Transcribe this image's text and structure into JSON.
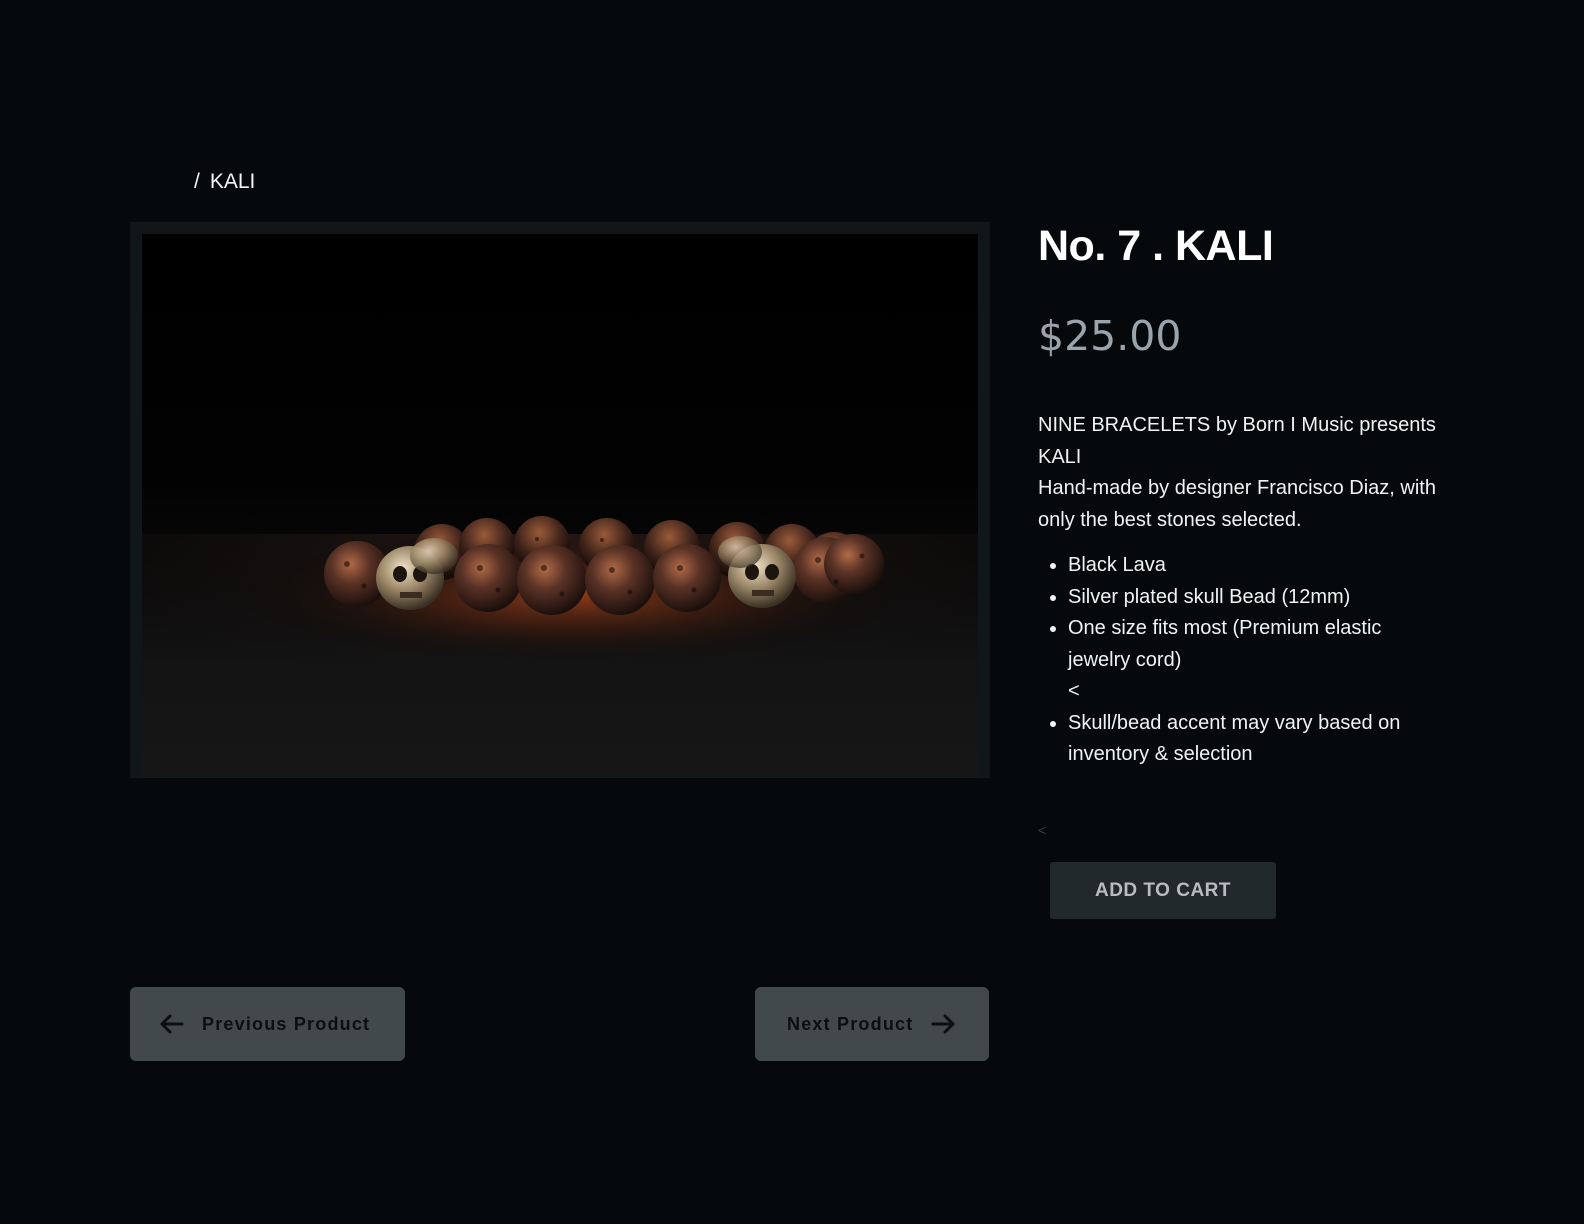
{
  "breadcrumb": {
    "separator": "/",
    "current": "KALI"
  },
  "product": {
    "title": "No. 7 . KALI",
    "price": "$25.00",
    "image_icon": "bracelet-photo",
    "description_lines": [
      "NINE BRACELETS by Born I Music presents KALI",
      "Hand-made by designer Francisco Diaz, with only the best stones selected."
    ],
    "features": [
      "Black Lava",
      "Silver plated skull Bead (12mm)",
      "One size fits most (Premium elastic jewelry cord)",
      "<",
      "Skull/bead accent may vary based on inventory & selection"
    ],
    "stray_text": "<"
  },
  "actions": {
    "add_to_cart": "ADD TO CART"
  },
  "navigation": {
    "previous_label": "Previous Product",
    "next_label": "Next Product",
    "previous_icon": "arrow-left-icon",
    "next_icon": "arrow-right-icon"
  },
  "colors": {
    "background": "#06090b",
    "price": "#9aa4ad",
    "button_dark": "#22292d",
    "nav_button": "#41494c"
  }
}
